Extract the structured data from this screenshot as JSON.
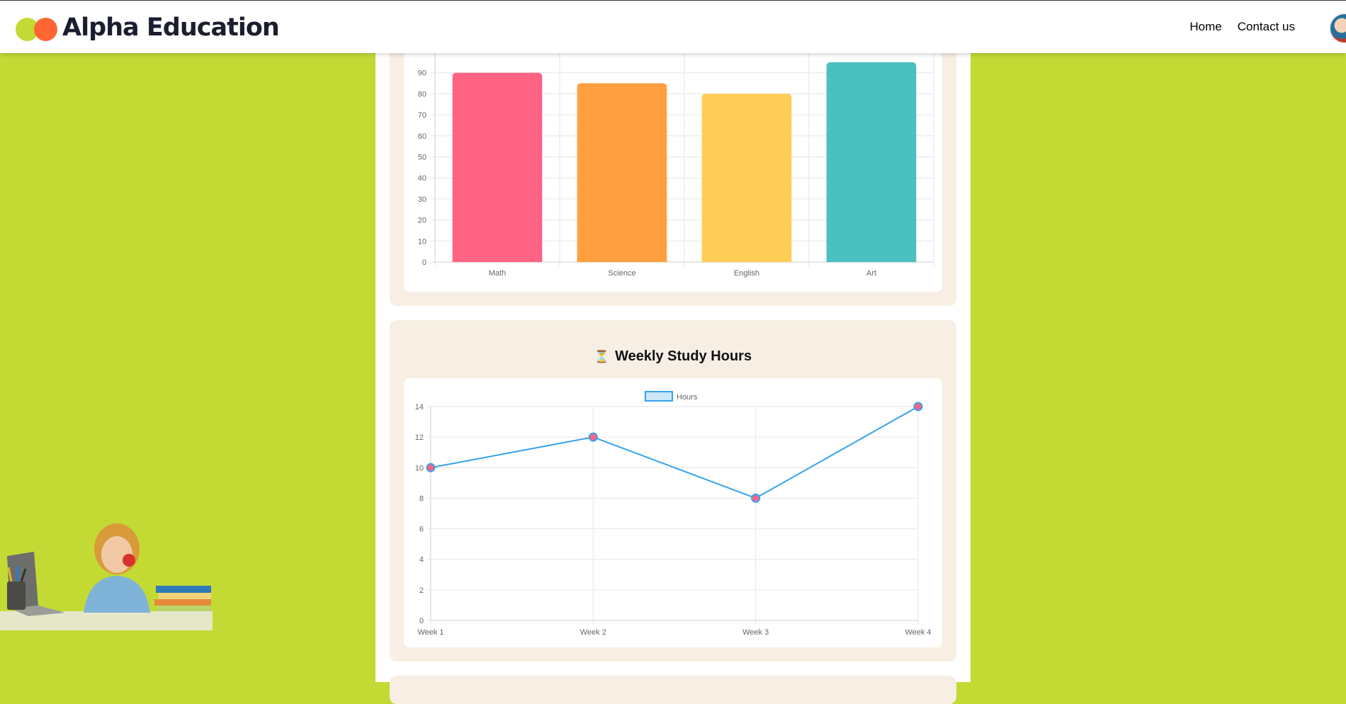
{
  "header": {
    "brand": "Alpha Education",
    "nav": [
      "Home",
      "Contact us"
    ],
    "colors": {
      "brand_lime": "#c3da35",
      "brand_orange": "#ff6633"
    }
  },
  "study_chart": {
    "title": "Weekly Study Hours",
    "title_icon": "⏳"
  },
  "chart_data": [
    {
      "type": "bar",
      "categories": [
        "Math",
        "Science",
        "English",
        "Art"
      ],
      "values": [
        90,
        85,
        80,
        95
      ],
      "colors": [
        "#ff6384",
        "#ff9f40",
        "#ffcd56",
        "#4bc0c0"
      ],
      "ylim": [
        0,
        100
      ],
      "yticks": [
        0,
        10,
        20,
        30,
        40,
        50,
        60,
        70,
        80,
        90
      ],
      "grid": true
    },
    {
      "type": "line",
      "categories": [
        "Week 1",
        "Week 2",
        "Week 3",
        "Week 4"
      ],
      "series": [
        {
          "name": "Hours",
          "values": [
            10,
            12,
            8,
            14
          ],
          "color": "#36a2eb",
          "point_color": "#ff6384"
        }
      ],
      "ylim": [
        0,
        14
      ],
      "yticks": [
        0,
        2,
        4,
        6,
        8,
        10,
        12,
        14
      ],
      "legend": "top-center",
      "grid": true
    }
  ]
}
